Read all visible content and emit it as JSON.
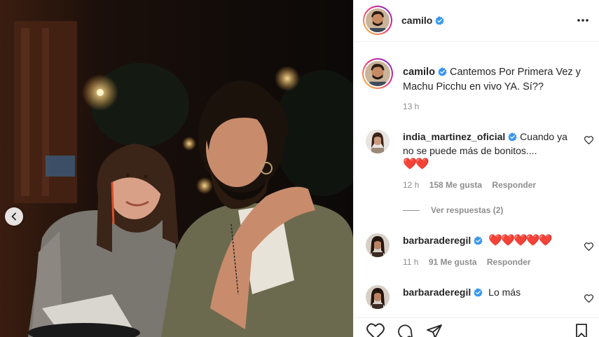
{
  "post": {
    "author": "camilo",
    "caption": "Cantemos Por Primera Vez y Machu Picchu en vivo YA. Sí??",
    "caption_age": "13 h"
  },
  "comments": [
    {
      "username": "india_martinez_oficial",
      "text": "Cuando ya no se puede más de bonitos....",
      "emoji": "❤️❤️",
      "age": "12 h",
      "likes": "158 Me gusta",
      "reply": "Responder",
      "view_replies": "Ver respuestas (2)"
    },
    {
      "username": "barbaraderegil",
      "text": "",
      "emoji": "❤️❤️❤️❤️❤️",
      "age": "11 h",
      "likes": "91 Me gusta",
      "reply": "Responder"
    },
    {
      "username": "barbaraderegil",
      "text": "Lo más"
    }
  ],
  "icons": {
    "verified": "verified-badge-icon",
    "more": "more-options-icon",
    "heart": "heart-icon",
    "comment": "comment-icon",
    "share": "share-icon",
    "save": "bookmark-icon",
    "prev": "chevron-left-icon"
  },
  "colors": {
    "verified": "#3897f0",
    "heart": "#ed4956",
    "muted": "#8e8e8e",
    "text": "#262626"
  }
}
